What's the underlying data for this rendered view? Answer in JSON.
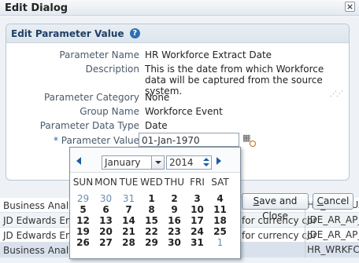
{
  "dialog": {
    "title": "Edit Dialog",
    "close_icon": "close-icon"
  },
  "panel": {
    "title": "Edit Parameter Value",
    "help_glyph": "?",
    "fields": {
      "parameter_name_label": "Parameter Name",
      "parameter_name_value": "HR Workforce Extract Date",
      "description_label": "Description",
      "description_value": "This is the date from which Workforce data will be captured from the source system.",
      "parameter_category_label": "Parameter Category",
      "parameter_category_value": "None",
      "group_name_label": "Group Name",
      "group_name_value": "Workforce Event",
      "parameter_data_type_label": "Parameter Data Type",
      "parameter_data_type_value": "Date",
      "required_marker": "*",
      "parameter_value_label": "Parameter Value",
      "parameter_value_value": "01-Jan-1970"
    }
  },
  "buttons": {
    "save_close_pre": "",
    "save_close_mnemonic": "S",
    "save_close_post": "ave and Close",
    "cancel_pre": "",
    "cancel_mnemonic": "C",
    "cancel_post": "ancel"
  },
  "background_table": {
    "rows": [
      {
        "c1": "Business Analytics",
        "c2": "",
        "c3": "HR_ACCRUAL"
      },
      {
        "c1": "JD Edwards Enter",
        "c2": "for currency cor",
        "c3": "JDE_AR_AP_E"
      },
      {
        "c1": "JD Edwards Enter",
        "c2": "for currency cor",
        "c3": "JDE_AR_AP_E"
      },
      {
        "c1": "Business Analytic",
        "c2": "",
        "c3": "HR_WRKFC_E"
      }
    ]
  },
  "calendar": {
    "month": "January",
    "year": "2014",
    "day_headers": [
      "SUN",
      "MON",
      "TUE",
      "WED",
      "THU",
      "FRI",
      "SAT"
    ],
    "weeks": [
      [
        {
          "d": "29",
          "o": true
        },
        {
          "d": "30",
          "o": true
        },
        {
          "d": "31",
          "o": true
        },
        {
          "d": "1",
          "o": false
        },
        {
          "d": "2",
          "o": false
        },
        {
          "d": "3",
          "o": false
        },
        {
          "d": "4",
          "o": false
        }
      ],
      [
        {
          "d": "5",
          "o": false
        },
        {
          "d": "6",
          "o": false
        },
        {
          "d": "7",
          "o": false
        },
        {
          "d": "8",
          "o": false
        },
        {
          "d": "9",
          "o": false
        },
        {
          "d": "10",
          "o": false
        },
        {
          "d": "11",
          "o": false
        }
      ],
      [
        {
          "d": "12",
          "o": false
        },
        {
          "d": "13",
          "o": false
        },
        {
          "d": "14",
          "o": false
        },
        {
          "d": "15",
          "o": false
        },
        {
          "d": "16",
          "o": false
        },
        {
          "d": "17",
          "o": false
        },
        {
          "d": "18",
          "o": false
        }
      ],
      [
        {
          "d": "19",
          "o": false
        },
        {
          "d": "20",
          "o": false
        },
        {
          "d": "21",
          "o": false
        },
        {
          "d": "22",
          "o": false
        },
        {
          "d": "23",
          "o": false
        },
        {
          "d": "24",
          "o": false
        },
        {
          "d": "25",
          "o": false
        }
      ],
      [
        {
          "d": "26",
          "o": false
        },
        {
          "d": "27",
          "o": false
        },
        {
          "d": "28",
          "o": false
        },
        {
          "d": "29",
          "o": false
        },
        {
          "d": "30",
          "o": false
        },
        {
          "d": "31",
          "o": false
        },
        {
          "d": "1",
          "o": true
        }
      ]
    ]
  },
  "colors": {
    "accent": "#2d6fb4",
    "header_text": "#1f3f66",
    "other_month": "#6a8db3"
  }
}
